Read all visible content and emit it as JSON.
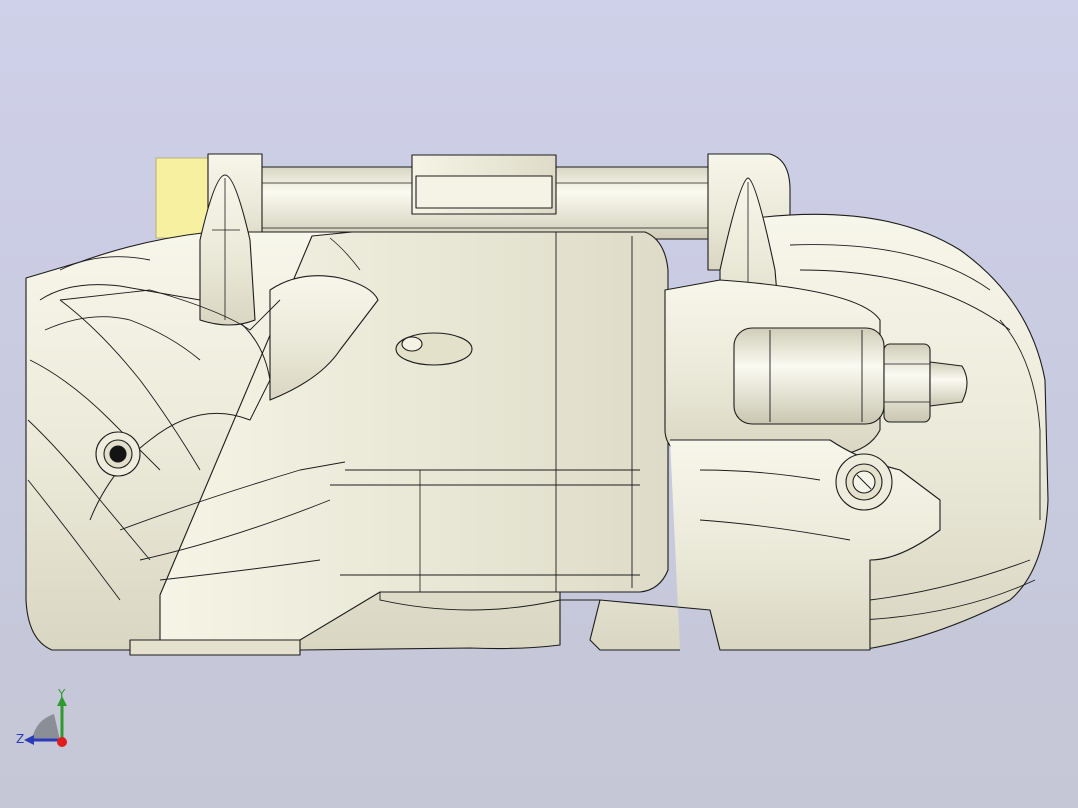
{
  "viewport": {
    "background_top": "#cfd0e9",
    "background_bottom": "#c5c7d6",
    "model_color": "#ecebd8",
    "edge_color": "#1c1c1c",
    "highlight_color": "#f6f0a0"
  },
  "triad": {
    "y_label": "Y",
    "z_label": "Z",
    "y_color": "#2e9a2e",
    "z_color": "#2b3bb8",
    "x_color": "#e01c1c"
  }
}
